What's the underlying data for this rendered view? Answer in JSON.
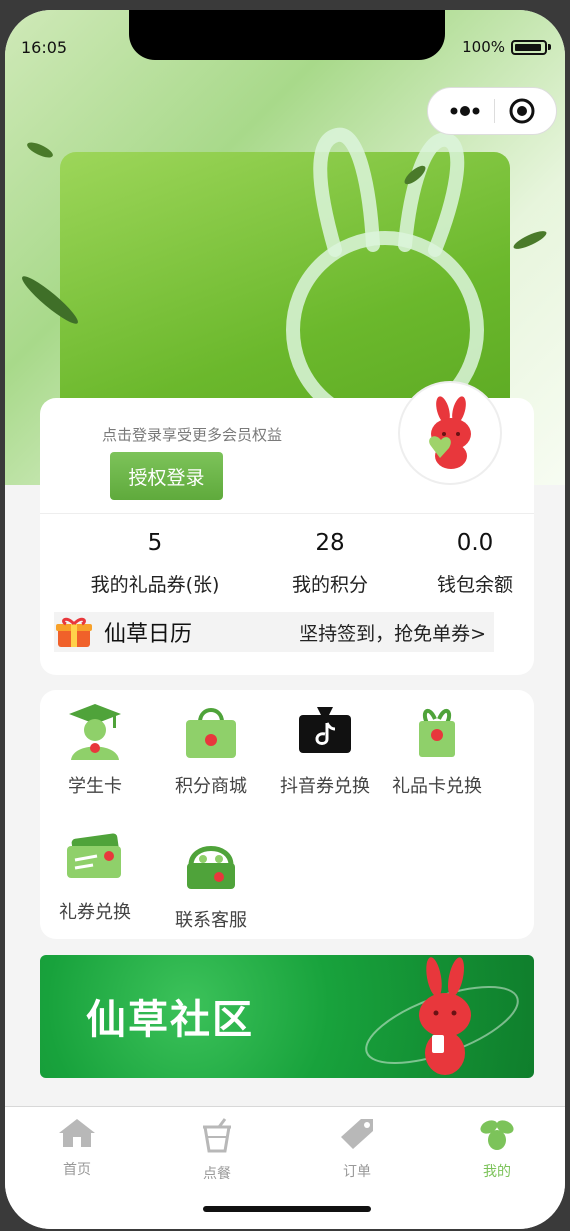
{
  "status": {
    "time": "16:05",
    "battery": "100%"
  },
  "member": {
    "login_hint": "点击登录享受更多会员权益",
    "login_button": "授权登录",
    "stats": [
      {
        "value": "5",
        "label": "我的礼品券(张)"
      },
      {
        "value": "28",
        "label": "我的积分"
      },
      {
        "value": "0.0",
        "label": "钱包余额"
      }
    ],
    "calendar": {
      "title": "仙草日历",
      "subtitle": "坚持签到，抢免单券>"
    }
  },
  "services": [
    {
      "label": "学生卡",
      "icon": "student-cap-icon"
    },
    {
      "label": "积分商城",
      "icon": "shopping-bag-icon"
    },
    {
      "label": "抖音券兑换",
      "icon": "douyin-ticket-icon"
    },
    {
      "label": "礼品卡兑换",
      "icon": "gift-card-icon"
    },
    {
      "label": "礼券兑换",
      "icon": "voucher-icon"
    },
    {
      "label": "联系客服",
      "icon": "headset-icon"
    }
  ],
  "banner": {
    "title": "仙草社区"
  },
  "tabs": [
    {
      "label": "首页",
      "icon": "home-icon"
    },
    {
      "label": "点餐",
      "icon": "drink-cup-icon"
    },
    {
      "label": "订单",
      "icon": "tag-icon"
    },
    {
      "label": "我的",
      "icon": "bunny-icon",
      "active": true
    }
  ],
  "colors": {
    "accent": "#7cc35a",
    "brand_red": "#e8373c"
  }
}
